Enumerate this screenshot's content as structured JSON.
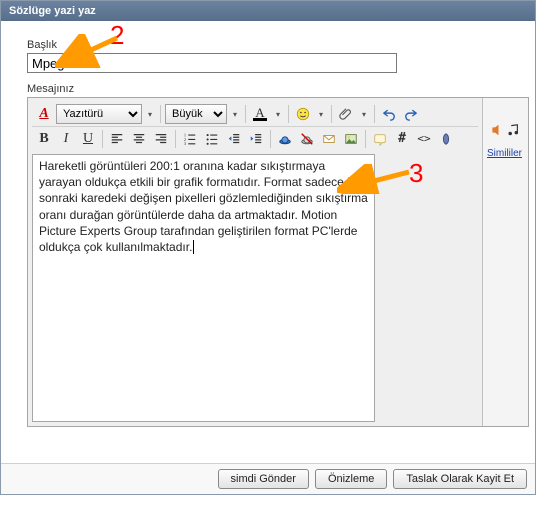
{
  "window": {
    "title": "Sözlüge yazi yaz"
  },
  "labels": {
    "title_field": "Başlık",
    "message_field": "Mesajınız"
  },
  "form": {
    "title_value": "Mpeg"
  },
  "toolbar": {
    "font_family": "Yazıtürü",
    "font_size": "Büyük",
    "font_color_label": "A"
  },
  "editor": {
    "body_text": "Hareketli görüntüleri 200:1 oranına kadar sıkıştırmaya yarayan oldukça etkili bir grafik formatıdır. Format sadece bir sonraki karedeki değişen pixelleri gözlemlediğinden sıkıştırma oranı durağan görüntülerde daha da artmaktadır. Motion Picture Experts Group tarafından geliştirilen format PC'lerde oldukça çok kullanılmaktadır."
  },
  "side_panel": {
    "link": "Simililer"
  },
  "buttons": {
    "submit": "simdi Gönder",
    "preview": "Önizleme",
    "save_draft": "Taslak Olarak Kayit Et"
  },
  "annotations": {
    "n2": "2",
    "n3": "3"
  }
}
